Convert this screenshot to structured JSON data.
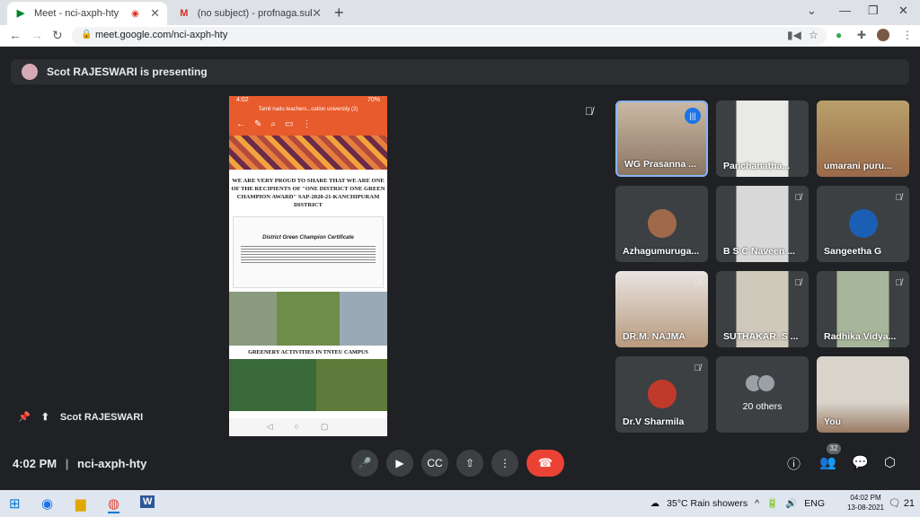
{
  "browser": {
    "tabs": [
      {
        "title": "Meet - nci-axph-hty",
        "favicon": "meet-icon"
      },
      {
        "title": "(no subject) - profnaga.subramar",
        "favicon": "gmail-icon"
      }
    ],
    "url": "meet.google.com/nci-axph-hty"
  },
  "meeting": {
    "presenting_banner": "Scot RAJESWARI is presenting",
    "presenter_label": "Scot RAJESWARI",
    "time": "4:02 PM",
    "code": "nci-axph-hty",
    "participant_count": "32"
  },
  "presentation": {
    "status_time": "4:02",
    "status_battery": "70%",
    "doc_title": "Tamil nadu teachers...cation university (2)",
    "heading": "WE ARE VERY PROUD TO SHARE THAT WE ARE ONE OF THE RECIPIENTS OF \"ONE DISTRICT ONE GREEN CHAMPION AWARD\" SAP-2020-21-KANCHIPURAM DISTRICT",
    "certificate_title": "District Green Champion Certificate",
    "greenery_title": "GREENERY ACTIVITIES IN TNTEU CAMPUS"
  },
  "participants": [
    {
      "name": "WG Prasanna ...",
      "speaking": true
    },
    {
      "name": "Panchanatha..."
    },
    {
      "name": "umarani puru..."
    },
    {
      "name": "Azhagumuruga..."
    },
    {
      "name": "B S C Naveen ..."
    },
    {
      "name": "Sangeetha G"
    },
    {
      "name": "DR.M. NAJMA"
    },
    {
      "name": "SUTHAKAR. S ..."
    },
    {
      "name": "Radhika Vidya..."
    },
    {
      "name": "Dr.V Sharmila"
    },
    {
      "name": "20 others"
    },
    {
      "name": "You"
    }
  ],
  "taskbar": {
    "weather": "35°C  Rain showers",
    "lang": "ENG",
    "time": "04:02 PM",
    "date": "13-08-2021",
    "notifications": "21"
  },
  "colors": {
    "leave": "#ea4335",
    "speaking_border": "#8ab4f8",
    "background": "#202124"
  }
}
